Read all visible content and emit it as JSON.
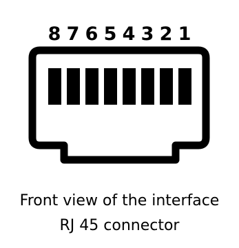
{
  "diagram": {
    "pin_numbers": [
      "8",
      "7",
      "6",
      "5",
      "4",
      "3",
      "2",
      "1"
    ]
  },
  "caption": {
    "line1": "Front view of the interface",
    "line2": "RJ 45 connector"
  },
  "colors": {
    "outline": "#000000",
    "pins": "#000000",
    "background": "#ffffff"
  }
}
